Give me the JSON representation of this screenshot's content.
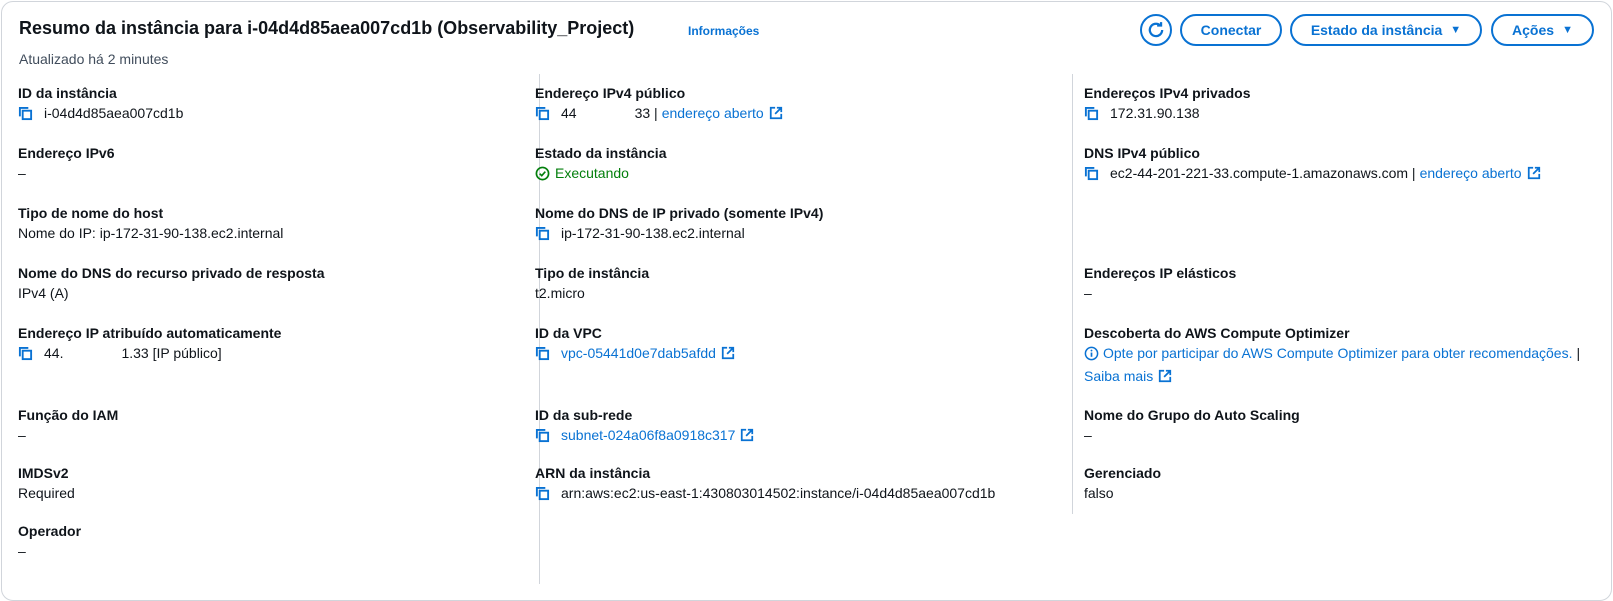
{
  "header": {
    "title": "Resumo da instância para i-04d4d85aea007cd1b (Observability_Project)",
    "info_link": "Informações",
    "updated": "Atualizado há 2 minutes",
    "buttons": {
      "connect": "Conectar",
      "instance_state": "Estado da instância",
      "actions": "Ações"
    }
  },
  "col1": {
    "instance_id": {
      "label": "ID da instância",
      "value": "i-04d4d85aea007cd1b"
    },
    "ipv6": {
      "label": "Endereço IPv6",
      "value": "–"
    },
    "hostname_type": {
      "label": "Tipo de nome do host",
      "value": "Nome do IP: ip-172-31-90-138.ec2.internal"
    },
    "private_dns_response": {
      "label": "Nome do DNS do recurso privado de resposta",
      "value": "IPv4 (A)"
    },
    "auto_ip": {
      "label": "Endereço IP atribuído automaticamente",
      "value_a": "44.",
      "value_b": "1.33 [IP público]"
    },
    "iam_role": {
      "label": "Função do IAM",
      "value": "–"
    },
    "imdsv2": {
      "label": "IMDSv2",
      "value": "Required"
    },
    "operator": {
      "label": "Operador",
      "value": "–"
    }
  },
  "col2": {
    "public_ipv4": {
      "label": "Endereço IPv4 público",
      "value_a": "44",
      "value_b": "33 |",
      "link": "endereço aberto"
    },
    "instance_state": {
      "label": "Estado da instância",
      "value": "Executando"
    },
    "private_dns_name": {
      "label": "Nome do DNS de IP privado (somente IPv4)",
      "value": "ip-172-31-90-138.ec2.internal"
    },
    "instance_type": {
      "label": "Tipo de instância",
      "value": "t2.micro"
    },
    "vpc_id": {
      "label": "ID da VPC",
      "value": "vpc-05441d0e7dab5afdd"
    },
    "subnet_id": {
      "label": "ID da sub-rede",
      "value": "subnet-024a06f8a0918c317"
    },
    "arn": {
      "label": "ARN da instância",
      "value": "arn:aws:ec2:us-east-1:430803014502:instance/i-04d4d85aea007cd1b"
    }
  },
  "col3": {
    "private_ipv4": {
      "label": "Endereços IPv4 privados",
      "value": "172.31.90.138"
    },
    "public_dns": {
      "label": "DNS IPv4 público",
      "value": "ec2-44-201-221-33.compute-1.amazonaws.com |",
      "link": "endereço aberto"
    },
    "elastic_ip": {
      "label": "Endereços IP elásticos",
      "value": "–"
    },
    "optimizer": {
      "label": "Descoberta do AWS Compute Optimizer",
      "value": "Opte por participar do AWS Compute Optimizer para obter recomendações.",
      "sep": "|",
      "more": "Saiba mais"
    },
    "asg": {
      "label": "Nome do Grupo do Auto Scaling",
      "value": "–"
    },
    "managed": {
      "label": "Gerenciado",
      "value": "falso"
    }
  },
  "colors": {
    "link": "#0972d3",
    "success": "#037f0c",
    "border": "#d1d5db",
    "text": "#0f141a"
  },
  "icons": [
    "refresh-icon",
    "caret-down-icon",
    "copy-icon",
    "external-link-icon",
    "check-circle-icon",
    "info-icon"
  ]
}
